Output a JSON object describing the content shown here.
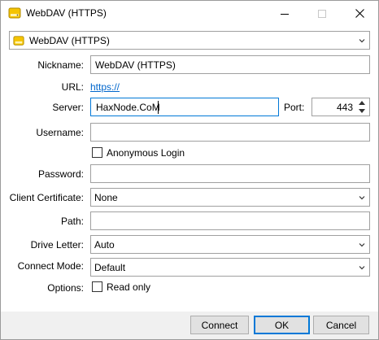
{
  "window": {
    "title": "WebDAV (HTTPS)",
    "app_icon": "drive-icon",
    "controls": [
      "minimize-icon",
      "maximize-icon",
      "close-icon"
    ]
  },
  "profile": {
    "selected": "WebDAV (HTTPS)",
    "icon": "drive-icon"
  },
  "form": {
    "nickname_label": "Nickname:",
    "nickname_value": "WebDAV (HTTPS)",
    "url_label": "URL:",
    "url_value": "https://",
    "server_label": "Server:",
    "server_value": "HaxNode.CoM",
    "port_label": "Port:",
    "port_value": "443",
    "username_label": "Username:",
    "username_value": "",
    "anonymous_label": "Anonymous Login",
    "anonymous_checked": false,
    "password_label": "Password:",
    "password_value": "",
    "client_cert_label": "Client Certificate:",
    "client_cert_value": "None",
    "path_label": "Path:",
    "path_value": "",
    "drive_letter_label": "Drive Letter:",
    "drive_letter_value": "Auto",
    "connect_mode_label": "Connect Mode:",
    "connect_mode_value": "Default",
    "options_label": "Options:",
    "read_only_label": "Read only",
    "read_only_checked": false
  },
  "buttons": {
    "connect": "Connect",
    "ok": "OK",
    "cancel": "Cancel"
  },
  "colors": {
    "accent": "#0078d7",
    "link": "#0066cc",
    "footer_bg": "#f0f0f0",
    "icon_yellow": "#f5c400"
  }
}
